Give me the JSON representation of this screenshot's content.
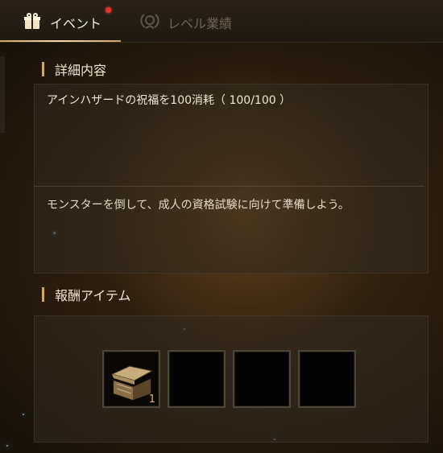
{
  "tabs": [
    {
      "label": "イベント",
      "icon": "gift-icon",
      "active": true,
      "notification": true
    },
    {
      "label": "レベル業績",
      "icon": "laurel-icon",
      "active": false
    }
  ],
  "details": {
    "heading": "詳細内容",
    "quest_title": "アインハザードの祝福を100消耗（ 100/100 ）",
    "description": "モンスターを倒して、成人の資格試験に向けて準備しよう。"
  },
  "rewards": {
    "heading": "報酬アイテム",
    "slots": [
      {
        "item": "chest-icon",
        "quantity": "1"
      },
      {
        "item": null,
        "quantity": ""
      },
      {
        "item": null,
        "quantity": ""
      },
      {
        "item": null,
        "quantity": ""
      }
    ]
  },
  "colors": {
    "accent": "#d4a95b",
    "notification": "#e8332a",
    "quantity": "#e0b35a"
  }
}
